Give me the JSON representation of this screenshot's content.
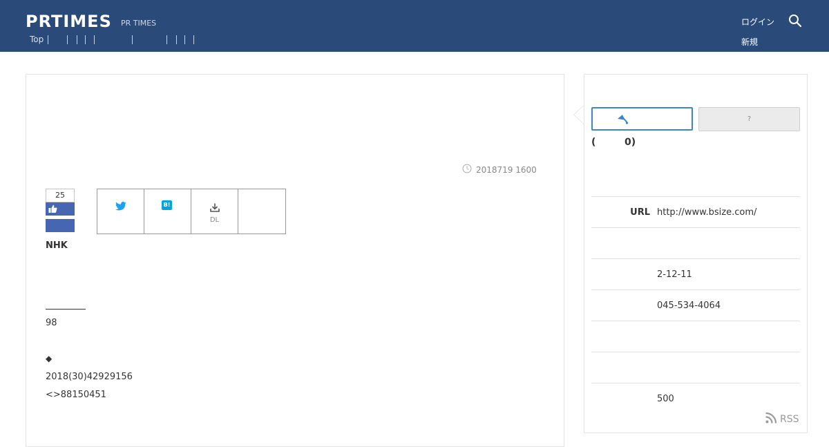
{
  "header": {
    "logo": "PRTIMES",
    "logo_sub": "PR TIMES",
    "nav_top": "Top",
    "link_1": "ログイン",
    "link_2": "新規"
  },
  "article": {
    "date": "2018719 1600",
    "like_count": "25",
    "company": "NHK",
    "dl_label": "DL",
    "line_1": "98",
    "bullet": "◆",
    "line_2": "2018(30)42929156",
    "line_3": "<>88150451"
  },
  "sidebar": {
    "help_label": "?",
    "followers_open": "(",
    "followers_count": "0)",
    "rows": [
      {
        "label": "URL",
        "value": "http://www.bsize.com/"
      },
      {
        "label": "",
        "value": ""
      },
      {
        "label": "",
        "value": "2-12-11"
      },
      {
        "label": "",
        "value": "045-534-4064"
      },
      {
        "label": "",
        "value": ""
      },
      {
        "label": "",
        "value": ""
      },
      {
        "label": "",
        "value": "500"
      }
    ],
    "rss_label": "RSS"
  },
  "colors": {
    "header_bg": "#2a4a7a",
    "facebook_blue": "#4766b1",
    "follow_blue": "#3d84c6",
    "twitter_blue": "#1da1f2",
    "hatena_blue": "#00a4de"
  }
}
